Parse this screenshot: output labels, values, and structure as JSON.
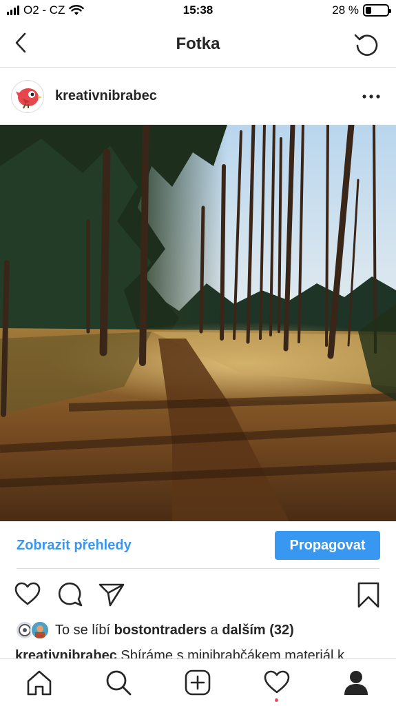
{
  "status_bar": {
    "carrier": "O2 - CZ",
    "time": "15:38",
    "battery_text": "28 %",
    "battery_level": 0.28
  },
  "header": {
    "title": "Fotka",
    "back_icon": "chevron-left-icon",
    "refresh_icon": "refresh-icon"
  },
  "post": {
    "username": "kreativnibrabec",
    "avatar_icon": "red-bird-avatar",
    "more_icon": "more-horizontal-icon",
    "photo_desc_icon": "forest-path-photo"
  },
  "insights": {
    "link_label": "Zobrazit přehledy",
    "promote_label": "Propagovat",
    "accent_color": "#3897f0"
  },
  "actions": {
    "icons": [
      "heart-icon",
      "comment-icon",
      "send-icon",
      "bookmark-icon"
    ]
  },
  "likes": {
    "prefix": "To se líbí",
    "user": "bostontraders",
    "conjunction": "a",
    "others": "dalším (32)"
  },
  "caption": {
    "username": "kreativnibrabec",
    "text": "Sbíráme s minibrabčákem materiál k"
  },
  "tabbar": {
    "icons": [
      "home-icon",
      "search-icon",
      "add-post-icon",
      "activity-heart-icon",
      "profile-icon"
    ],
    "notification_color": "#ed4956"
  }
}
